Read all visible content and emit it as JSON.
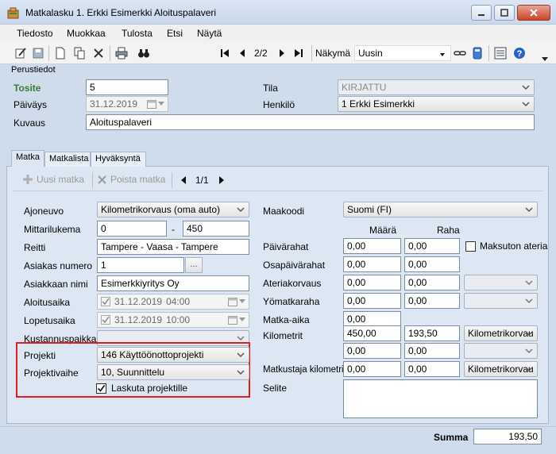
{
  "window": {
    "title": "Matkalasku 1. Erkki Esimerkki Aloituspalaveri"
  },
  "menu": [
    "Tiedosto",
    "Muokkaa",
    "Tulosta",
    "Etsi",
    "Näytä"
  ],
  "toolbar": {
    "page": "2/2",
    "view_label": "Näkymä",
    "view_value": "Uusin"
  },
  "header": {
    "section_title": "Perustiedot",
    "tosite_label": "Tosite",
    "tosite_value": "5",
    "paivays_label": "Päiväys",
    "paivays_value": "31.12.2019",
    "kuvaus_label": "Kuvaus",
    "kuvaus_value": "Aloituspalaveri",
    "tila_label": "Tila",
    "tila_value": "KIRJATTU",
    "henkilo_label": "Henkilö",
    "henkilo_value": "1 Erkki Esimerkki"
  },
  "tabs": [
    "Matka",
    "Matkalista",
    "Hyväksyntä"
  ],
  "subtoolbar": {
    "new_label": "Uusi matka",
    "delete_label": "Poista matka",
    "page": "1/1"
  },
  "left": {
    "ajoneuvo_label": "Ajoneuvo",
    "ajoneuvo_value": "Kilometrikorvaus (oma auto)",
    "mittari_label": "Mittarilukema",
    "mittari_start": "0",
    "mittari_dash": "-",
    "mittari_end": "450",
    "reitti_label": "Reitti",
    "reitti_value": "Tampere - Vaasa - Tampere",
    "asiakasnro_label": "Asiakas numero",
    "asiakasnro_value": "1",
    "browse_label": "...",
    "asiakasnimi_label": "Asiakkaan nimi",
    "asiakasnimi_value": "Esimerkkiyritys Oy",
    "aloitus_label": "Aloitusaika",
    "aloitus_date": "31.12.2019",
    "aloitus_time": "04:00",
    "lopetus_label": "Lopetusaika",
    "lopetus_date": "31.12.2019",
    "lopetus_time": "10:00",
    "kustannus_label": "Kustannuspaikka",
    "projekti_label": "Projekti",
    "projekti_value": "146 Käyttöönottoprojekti",
    "vaihe_label": "Projektivaihe",
    "vaihe_value": "10, Suunnittelu",
    "laskuta_label": "Laskuta projektille"
  },
  "right": {
    "maakoodi_label": "Maakoodi",
    "maakoodi_value": "Suomi (FI)",
    "maara_header": "Määrä",
    "raha_header": "Raha",
    "rows": [
      {
        "label": "Päivärahat",
        "maara": "0,00",
        "raha": "0,00"
      },
      {
        "label": "Osapäivärahat",
        "maara": "0,00",
        "raha": "0,00"
      },
      {
        "label": "Ateriakorvaus",
        "maara": "0,00",
        "raha": "0,00"
      },
      {
        "label": "Yömatkaraha",
        "maara": "0,00",
        "raha": "0,00"
      },
      {
        "label": "Matka-aika",
        "maara": "0,00"
      },
      {
        "label": "Kilometrit",
        "maara": "450,00",
        "raha": "193,50",
        "combo": "Kilometrikorvau"
      },
      {
        "label": "",
        "maara": "0,00",
        "raha": "0,00"
      },
      {
        "label": "Matkustaja kilometrit",
        "maara": "0,00",
        "raha": "0,00",
        "combo": "Kilometrikorvau"
      }
    ],
    "maksuton_label": "Maksuton ateria",
    "selite_label": "Selite"
  },
  "footer": {
    "summa_label": "Summa",
    "summa_value": "193,50"
  },
  "colors": {
    "highlight": "#e02020",
    "tosite_green": "#3b7a32"
  }
}
